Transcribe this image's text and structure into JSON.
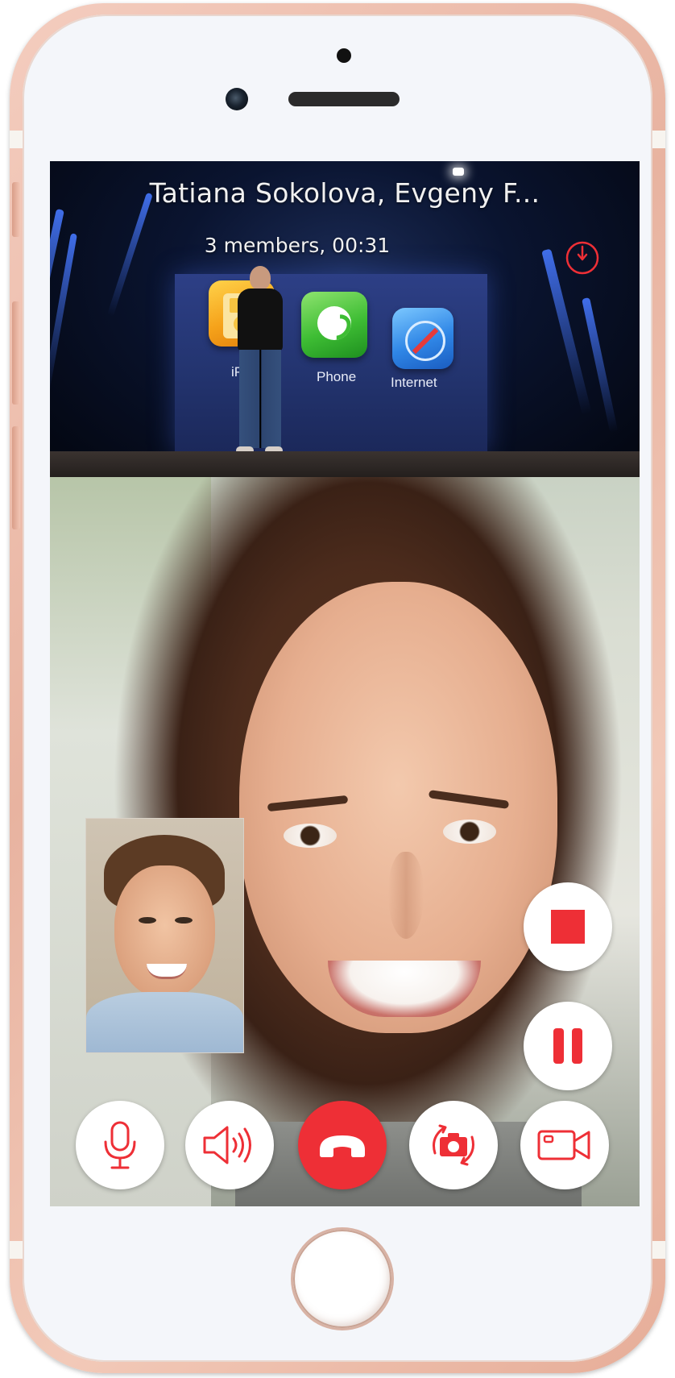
{
  "call": {
    "title": "Tatiana Sokolova, Evgeny F...",
    "status": "3 members, 00:31"
  },
  "presentation": {
    "app_labels": [
      "iPod",
      "Phone",
      "Internet"
    ]
  },
  "controls": {
    "side": [
      "stop-icon",
      "pause-icon"
    ],
    "bottom": [
      "microphone-icon",
      "speaker-icon",
      "end-call-icon",
      "switch-camera-icon",
      "video-camera-icon"
    ]
  },
  "colors": {
    "accent": "#ee2f36",
    "button_bg": "#ffffff"
  }
}
